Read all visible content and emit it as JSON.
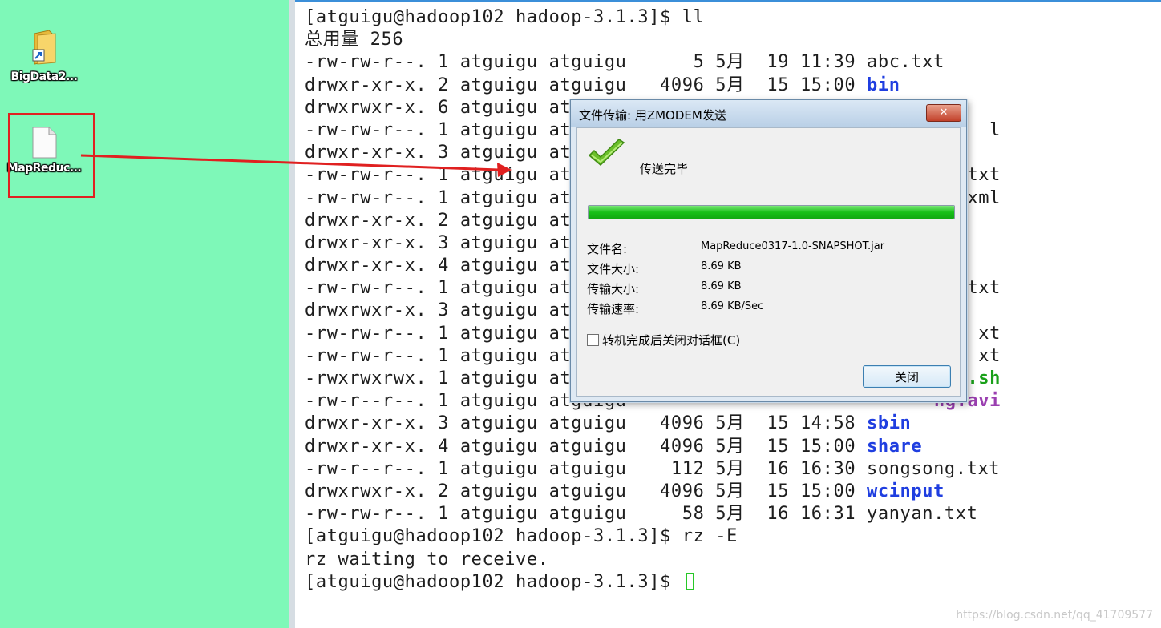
{
  "desktop": {
    "icons": [
      {
        "name": "BigData2..."
      },
      {
        "name": "MapReduc..."
      }
    ]
  },
  "terminal": {
    "lines": [
      {
        "text": "[atguigu@hadoop102 hadoop-3.1.3]$ ll"
      },
      {
        "text": "总用量 256"
      },
      {
        "text": "-rw-rw-r--. 1 atguigu atguigu      5 5月  19 11:39 abc.txt"
      },
      {
        "text": "drwxr-xr-x. 2 atguigu atguigu   4096 5月  15 15:00 ",
        "suffix": "bin",
        "suffix_color": "#1f3ee0"
      },
      {
        "text": "drwxrwxr-x. 6 atguigu atguigu"
      },
      {
        "text": "-rw-rw-r--. 1 atguigu atguigu",
        "tail": "l"
      },
      {
        "text": "drwxr-xr-x. 3 atguigu atguigu"
      },
      {
        "text": "-rw-rw-r--. 1 atguigu atguigu",
        "tail": ".txt"
      },
      {
        "text": "-rw-rw-r--. 1 atguigu atguigu",
        "tail": "xml"
      },
      {
        "text": "drwxr-xr-x. 2 atguigu atguigu"
      },
      {
        "text": "drwxr-xr-x. 3 atguigu atguigu"
      },
      {
        "text": "drwxr-xr-x. 4 atguigu atguigu"
      },
      {
        "text": "-rw-rw-r--. 1 atguigu atguigu",
        "tail": "txt"
      },
      {
        "text": "drwxrwxr-x. 3 atguigu atguigu"
      },
      {
        "text": "-rw-rw-r--. 1 atguigu atguigu",
        "tail": "xt"
      },
      {
        "text": "-rw-rw-r--. 1 atguigu atguigu",
        "tail": "xt"
      },
      {
        "text": "-rwxrwxrwx. 1 atguigu atguigu",
        "tail": ".sh",
        "tail_color": "#1aa01a"
      },
      {
        "text": "-rw-r--r--. 1 atguigu atguigu",
        "tail": "ng.avi",
        "tail_color": "#9a3fb0"
      },
      {
        "text": "drwxr-xr-x. 3 atguigu atguigu   4096 5月  15 14:58 ",
        "suffix": "sbin",
        "suffix_color": "#1f3ee0"
      },
      {
        "text": "drwxr-xr-x. 4 atguigu atguigu   4096 5月  15 15:00 ",
        "suffix": "share",
        "suffix_color": "#1f3ee0"
      },
      {
        "text": "-rw-r--r--. 1 atguigu atguigu    112 5月  16 16:30 songsong.txt"
      },
      {
        "text": "drwxrwxr-x. 2 atguigu atguigu   4096 5月  15 15:00 ",
        "suffix": "wcinput",
        "suffix_color": "#1f3ee0"
      },
      {
        "text": "-rw-rw-r--. 1 atguigu atguigu     58 5月  16 16:31 yanyan.txt"
      },
      {
        "text": "[atguigu@hadoop102 hadoop-3.1.3]$ rz -E"
      },
      {
        "text": "rz waiting to receive."
      },
      {
        "text": "[atguigu@hadoop102 hadoop-3.1.3]$ ",
        "cursor": true
      }
    ]
  },
  "dialog": {
    "title": "文件传输: 用ZMODEM发送",
    "close_glyph": "✕",
    "status": "传送完毕",
    "progress": 1.0,
    "file_name_label": "文件名:",
    "file_name": "MapReduce0317-1.0-SNAPSHOT.jar",
    "file_size_label": "文件大小:",
    "file_size": "8.69 KB",
    "transfer_size_label": "传输大小:",
    "transfer_size": "8.69 KB",
    "transfer_rate_label": "传输速率:",
    "transfer_rate": "8.69 KB/Sec",
    "autoclose_label": "转机完成后关闭对话框(C)",
    "autoclose_checked": false,
    "close_button": "关闭"
  },
  "watermark": "https://blog.csdn.net/qq_41709577",
  "colors": {
    "desktop_bg": "#7ef8b8",
    "annotation": "#e02020",
    "progress_fill": "#18c018"
  }
}
